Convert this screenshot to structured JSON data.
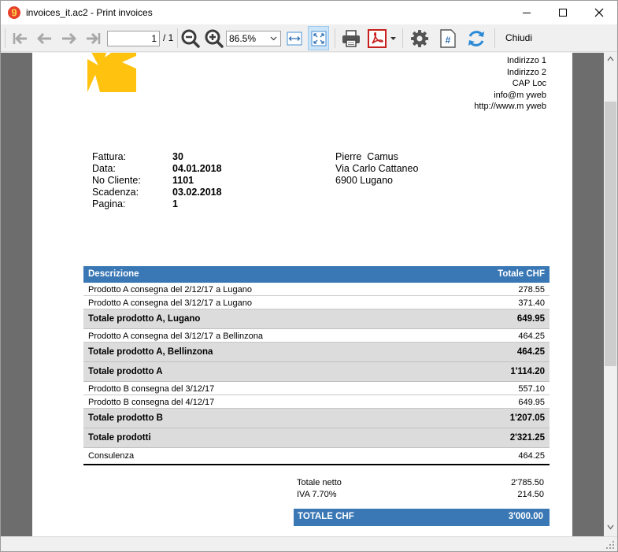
{
  "window": {
    "title": "invoices_it.ac2 - Print invoices",
    "app_icon": "banana-app-icon",
    "controls": [
      "minimize-icon",
      "maximize-icon",
      "close-icon"
    ]
  },
  "toolbar": {
    "page_number": "1",
    "page_total": "/ 1",
    "zoom": "86.5%",
    "close_label": "Chiudi",
    "icons": [
      "first-page-icon",
      "previous-page-icon",
      "next-page-icon",
      "last-page-icon",
      "zoom-out-icon",
      "zoom-in-icon",
      "fit-width-icon",
      "fit-page-icon",
      "print-icon",
      "pdf-icon",
      "settings-icon",
      "page-number-icon",
      "refresh-icon"
    ]
  },
  "colors": {
    "accent_blue": "#3a78b5",
    "total_row_grey": "#dcdcdc",
    "logo_yellow": "#ffc20e",
    "viewer_background": "#6d6d6d"
  },
  "invoice": {
    "sender": [
      "Indirizzo 1",
      "Indirizzo 2",
      "CAP Loc",
      "info@m yweb",
      "http://www.m yweb"
    ],
    "info": [
      {
        "label": "Fattura:",
        "value": "30"
      },
      {
        "label": "Data:",
        "value": "04.01.2018"
      },
      {
        "label": "No Cliente:",
        "value": "1101"
      },
      {
        "label": "Scadenza:",
        "value": "03.02.2018"
      },
      {
        "label": "Pagina:",
        "value": "1"
      }
    ],
    "recipient": [
      "Pierre  Camus",
      "Via Carlo Cattaneo",
      "6900 Lugano"
    ],
    "table": {
      "col_description": "Descrizione",
      "col_total": "Totale CHF",
      "rows": [
        {
          "desc": "Prodotto A consegna del 2/12/17 a Lugano",
          "amount": "278.55"
        },
        {
          "desc": "Prodotto A consegna del 3/12/17 a Lugano",
          "amount": "371.40"
        },
        {
          "desc": "Totale prodotto A, Lugano",
          "amount": "649.95"
        },
        {
          "desc": "Prodotto A consegna del 3/12/17 a Bellinzona",
          "amount": "464.25"
        },
        {
          "desc": "Totale prodotto A, Bellinzona",
          "amount": "464.25"
        },
        {
          "desc": "Totale prodotto A",
          "amount": "1'114.20"
        },
        {
          "desc": "Prodotto B consegna del 3/12/17",
          "amount": "557.10"
        },
        {
          "desc": "Prodotto B consegna del 4/12/17",
          "amount": "649.95"
        },
        {
          "desc": "Totale prodotto B",
          "amount": "1'207.05"
        },
        {
          "desc": "Totale prodotti",
          "amount": "2'321.25"
        },
        {
          "desc": "Consulenza",
          "amount": "464.25"
        }
      ]
    },
    "summary": {
      "net_label": "Totale netto",
      "net_value": "2'785.50",
      "vat_label": "IVA 7.70%",
      "vat_value": "214.50",
      "total_label": "TOTALE CHF",
      "total_value": "3'000.00"
    }
  }
}
